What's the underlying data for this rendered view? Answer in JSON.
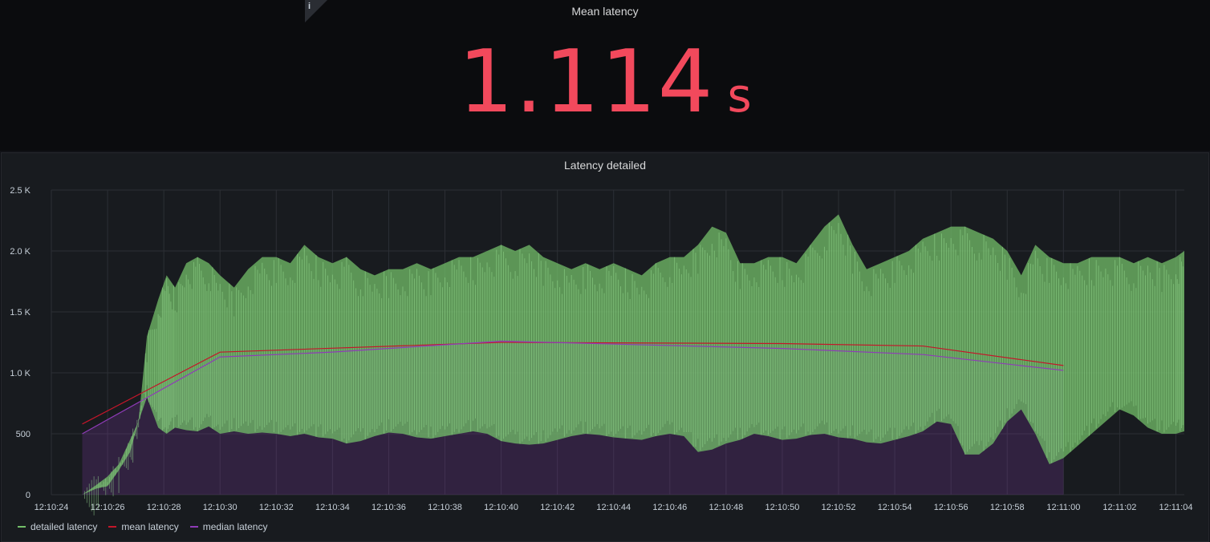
{
  "stat": {
    "title": "Mean latency",
    "value": "1.114",
    "unit": "s",
    "info_icon": "i",
    "color": "#f2495c"
  },
  "graph": {
    "title": "Latency detailed"
  },
  "chart_data": {
    "type": "area",
    "title": "Latency detailed",
    "xlabel": "",
    "ylabel": "",
    "ylim": [
      0,
      2500
    ],
    "yticks": [
      "0",
      "500",
      "1.0 K",
      "1.5 K",
      "2.0 K",
      "2.5 K"
    ],
    "xticks": [
      "12:10:24",
      "12:10:26",
      "12:10:28",
      "12:10:30",
      "12:10:32",
      "12:10:34",
      "12:10:36",
      "12:10:38",
      "12:10:40",
      "12:10:42",
      "12:10:44",
      "12:10:46",
      "12:10:48",
      "12:10:50",
      "12:10:52",
      "12:10:54",
      "12:10:56",
      "12:10:58",
      "12:11:00",
      "12:11:02",
      "12:11:04"
    ],
    "grid": true,
    "legend_placement": "bottom-left",
    "series": [
      {
        "name": "detailed latency",
        "color": "#73bf69",
        "x": [
          25.1,
          25.6,
          26.0,
          26.4,
          26.8,
          27.1,
          27.4,
          27.8,
          28.1,
          28.4,
          28.8,
          29.2,
          29.6,
          30.0,
          30.5,
          31.0,
          31.5,
          32.0,
          32.5,
          33.0,
          33.5,
          34.0,
          34.5,
          35.0,
          35.5,
          36.0,
          36.5,
          37.0,
          37.5,
          38.0,
          38.5,
          39.0,
          39.5,
          40.0,
          40.5,
          41.0,
          41.5,
          42.0,
          42.5,
          43.0,
          43.5,
          44.0,
          44.5,
          45.0,
          45.5,
          46.0,
          46.5,
          47.0,
          47.5,
          48.0,
          48.5,
          49.0,
          49.5,
          50.0,
          50.5,
          51.0,
          51.5,
          52.0,
          52.5,
          53.0,
          53.5,
          54.0,
          54.5,
          55.0,
          55.5,
          56.0,
          56.5,
          57.0,
          57.5,
          58.0,
          58.5,
          59.0,
          59.5,
          60.0,
          60.5,
          61.0,
          61.5,
          62.0,
          62.5,
          63.0,
          63.5,
          64.0,
          64.3
        ],
        "high": [
          0,
          80,
          150,
          250,
          450,
          600,
          1300,
          1600,
          1800,
          1700,
          1900,
          1950,
          1900,
          1800,
          1700,
          1850,
          1950,
          1950,
          1900,
          2050,
          1950,
          1900,
          1950,
          1850,
          1800,
          1850,
          1850,
          1900,
          1850,
          1900,
          1950,
          1950,
          2000,
          2050,
          2000,
          2050,
          1950,
          1900,
          1850,
          1900,
          1850,
          1900,
          1850,
          1800,
          1900,
          1950,
          1950,
          2050,
          2200,
          2150,
          1900,
          1900,
          1950,
          1950,
          1900,
          2050,
          2200,
          2300,
          2050,
          1850,
          1900,
          1950,
          2000,
          2100,
          2150,
          2200,
          2200,
          2150,
          2100,
          2000,
          1800,
          2050,
          1950,
          1900,
          1900,
          1950,
          1950,
          1950,
          1900,
          1950,
          1900,
          1950,
          2000
        ],
        "low": [
          0,
          50,
          70,
          200,
          350,
          600,
          800,
          550,
          500,
          550,
          530,
          520,
          560,
          500,
          520,
          500,
          510,
          500,
          480,
          500,
          470,
          460,
          420,
          440,
          480,
          510,
          500,
          470,
          460,
          480,
          500,
          520,
          500,
          440,
          420,
          410,
          420,
          450,
          480,
          500,
          490,
          470,
          460,
          450,
          480,
          500,
          480,
          350,
          370,
          420,
          450,
          500,
          480,
          450,
          460,
          490,
          500,
          470,
          460,
          430,
          420,
          450,
          480,
          520,
          600,
          580,
          330,
          330,
          420,
          600,
          700,
          500,
          250,
          300,
          400,
          500,
          600,
          700,
          650,
          550,
          500,
          500,
          520
        ]
      },
      {
        "name": "mean latency",
        "color": "#c4162a",
        "x": [
          25.1,
          30.0,
          40.0,
          50.0,
          55.0,
          60.0
        ],
        "y": [
          580,
          1170,
          1250,
          1240,
          1220,
          1060
        ]
      },
      {
        "name": "median latency",
        "color": "#8f3bb8",
        "x": [
          25.1,
          30.0,
          34.0,
          40.0,
          50.0,
          55.0,
          60.0
        ],
        "y": [
          500,
          1130,
          1170,
          1260,
          1200,
          1150,
          1020
        ]
      }
    ]
  }
}
